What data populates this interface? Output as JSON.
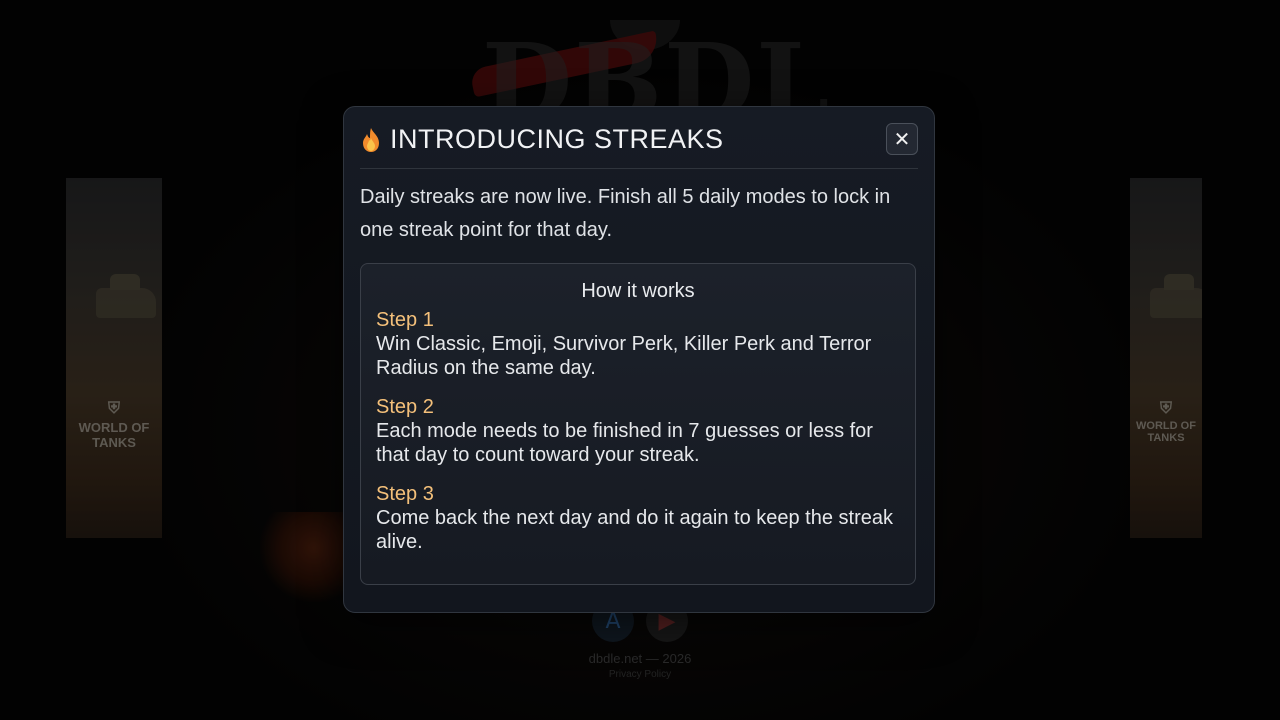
{
  "background": {
    "logo_text": "DBDLE",
    "ad_brand": "WORLD OF TANKS",
    "footer_copy": "dbdle.net — 2026",
    "footer_privacy": "Privacy Policy",
    "app_icons": [
      "app-store-icon",
      "google-play-icon"
    ]
  },
  "modal": {
    "title": "INTRODUCING STREAKS",
    "title_icon": "flame-icon",
    "close_label": "✕",
    "intro": "Daily streaks are now live. Finish all 5 daily modes to lock in one streak point for that day.",
    "how_title": "How it works",
    "steps": [
      {
        "label": "Step 1",
        "text": "Win Classic, Emoji, Survivor Perk, Killer Perk and Terror Radius on the same day."
      },
      {
        "label": "Step 2",
        "text": "Each mode needs to be finished in 7 guesses or less for that day to count toward your streak."
      },
      {
        "label": "Step 3",
        "text": "Come back the next day and do it again to keep the streak alive."
      }
    ]
  },
  "colors": {
    "accent_step": "#f4c07a",
    "modal_bg": "#161b24",
    "text": "#e6e8eb"
  }
}
